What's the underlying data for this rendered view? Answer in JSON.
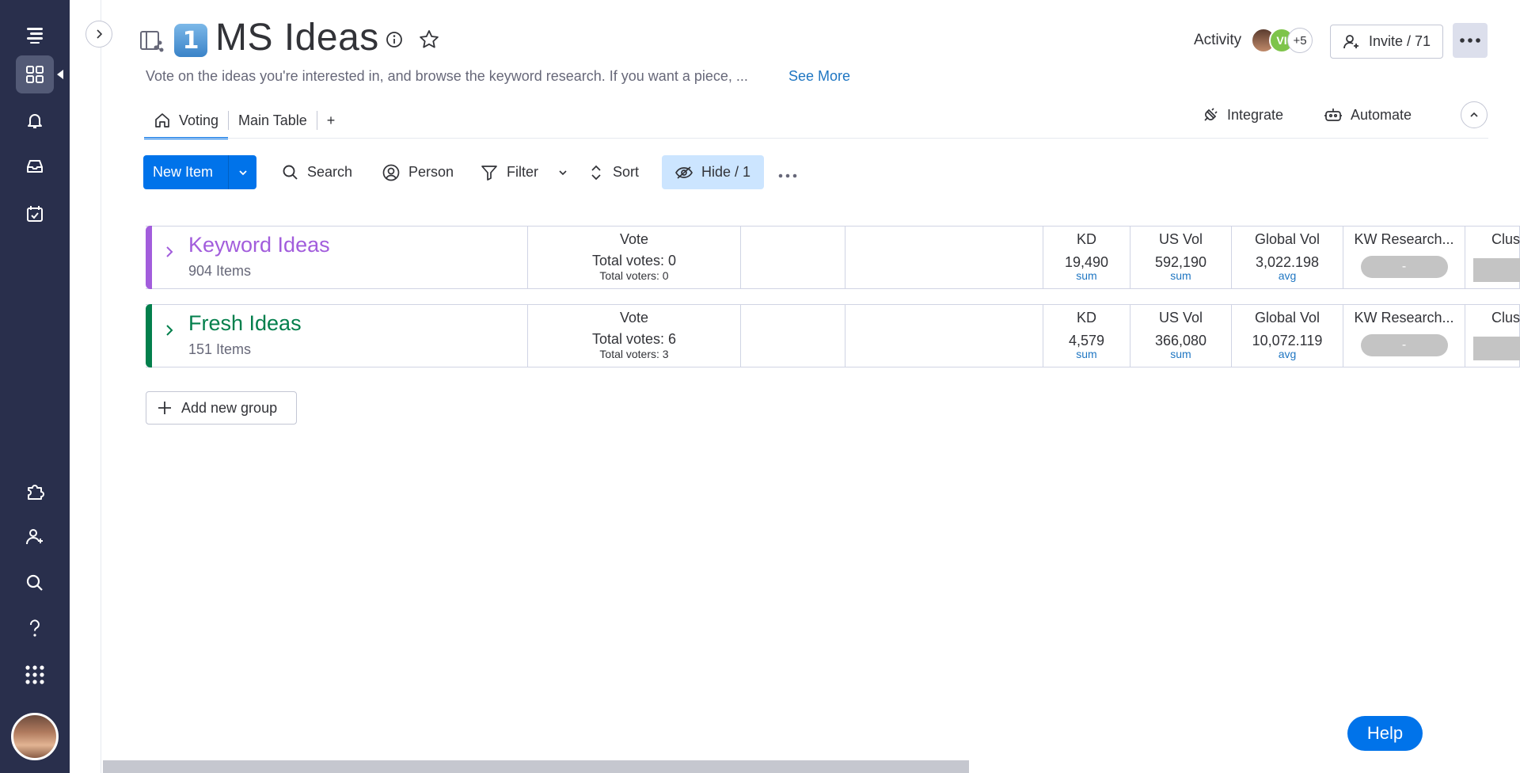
{
  "nav": {
    "icons": [
      "menu-icon",
      "workspace-grid-icon",
      "notifications-bell-icon",
      "inbox-icon",
      "my-work-calendar-icon",
      "apps-puzzle-icon",
      "invite-member-icon",
      "search-icon",
      "help-question-icon",
      "app-switcher-grid-icon"
    ]
  },
  "header": {
    "emoji_label": "1",
    "title": "MS Ideas",
    "description": "Vote on the ideas you're interested in, and browse the keyword research. If you want a piece, ...",
    "see_more": "See More",
    "activity_label": "Activity",
    "avatar_initials": "VI",
    "avatar_more": "+5",
    "invite_label": "Invite / 71",
    "more_label": "..."
  },
  "tabs": {
    "items": [
      {
        "label": "Voting"
      },
      {
        "label": "Main Table"
      }
    ],
    "add_label": "+",
    "integrate_label": "Integrate",
    "automate_label": "Automate"
  },
  "toolbar": {
    "new_item_label": "New Item",
    "search_label": "Search",
    "person_label": "Person",
    "filter_label": "Filter",
    "sort_label": "Sort",
    "hide_label": "Hide / 1"
  },
  "groups": [
    {
      "name": "Keyword Ideas",
      "count": "904 Items",
      "color": "#a25ddc",
      "vote_header": "Vote",
      "total_votes": "Total votes: 0",
      "total_voters": "Total voters: 0",
      "kd_header": "KD",
      "kd_value": "19,490",
      "kd_agg": "sum",
      "usvol_header": "US Vol",
      "usvol_value": "592,190",
      "usvol_agg": "sum",
      "globalvol_header": "Global Vol",
      "globalvol_value": "3,022.198",
      "globalvol_agg": "avg",
      "kwr_header": "KW Research...",
      "kwr_value": "-",
      "clus_header": "Clus"
    },
    {
      "name": "Fresh Ideas",
      "count": "151 Items",
      "color": "#037f4c",
      "vote_header": "Vote",
      "total_votes": "Total votes: 6",
      "total_voters": "Total voters: 3",
      "kd_header": "KD",
      "kd_value": "4,579",
      "kd_agg": "sum",
      "usvol_header": "US Vol",
      "usvol_value": "366,080",
      "usvol_agg": "sum",
      "globalvol_header": "Global Vol",
      "globalvol_value": "10,072.119",
      "globalvol_agg": "avg",
      "kwr_header": "KW Research...",
      "kwr_value": "-",
      "clus_header": "Clus"
    }
  ],
  "add_group_label": "Add new group",
  "help_label": "Help"
}
